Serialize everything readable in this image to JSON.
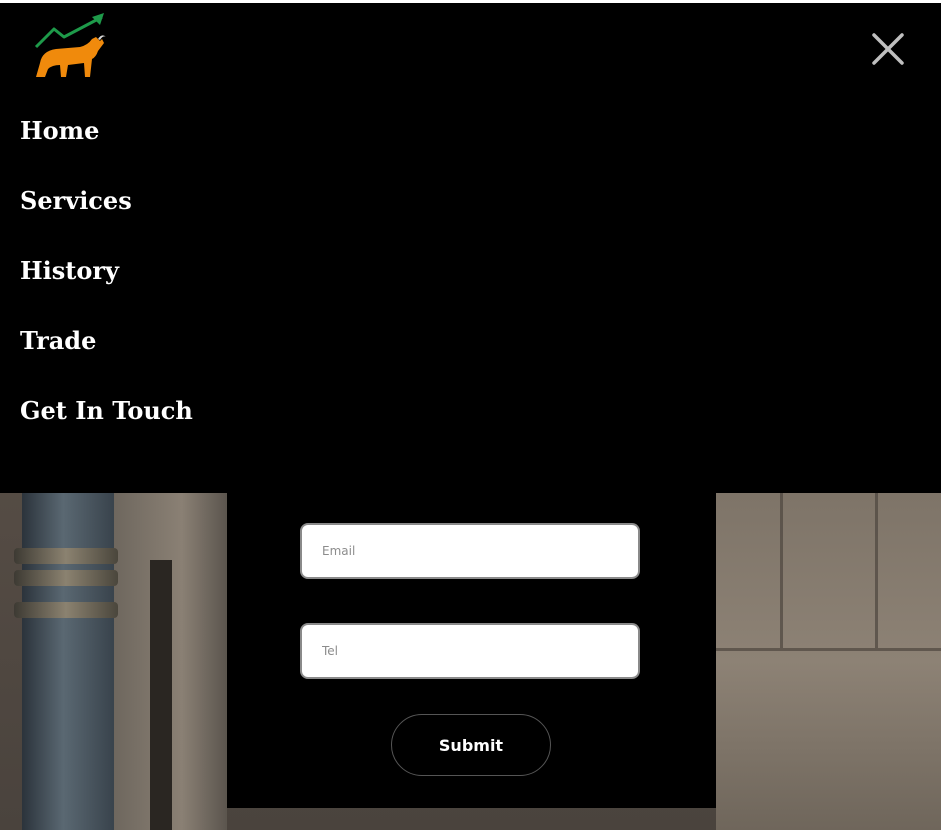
{
  "menu": {
    "items": [
      {
        "label": "Home"
      },
      {
        "label": "Services"
      },
      {
        "label": "History"
      },
      {
        "label": "Trade"
      },
      {
        "label": "Get In Touch"
      }
    ],
    "close_icon": "close-icon",
    "logo_icon": "bull-chart-logo"
  },
  "form": {
    "email_placeholder": "Email",
    "tel_placeholder": "Tel",
    "submit_label": "Submit"
  },
  "colors": {
    "overlay": "#000000",
    "nav_text": "#ffffff",
    "logo_bull": "#f08a0c",
    "logo_arrow": "#1e9a4a",
    "close_icon": "#bfbfbf"
  }
}
